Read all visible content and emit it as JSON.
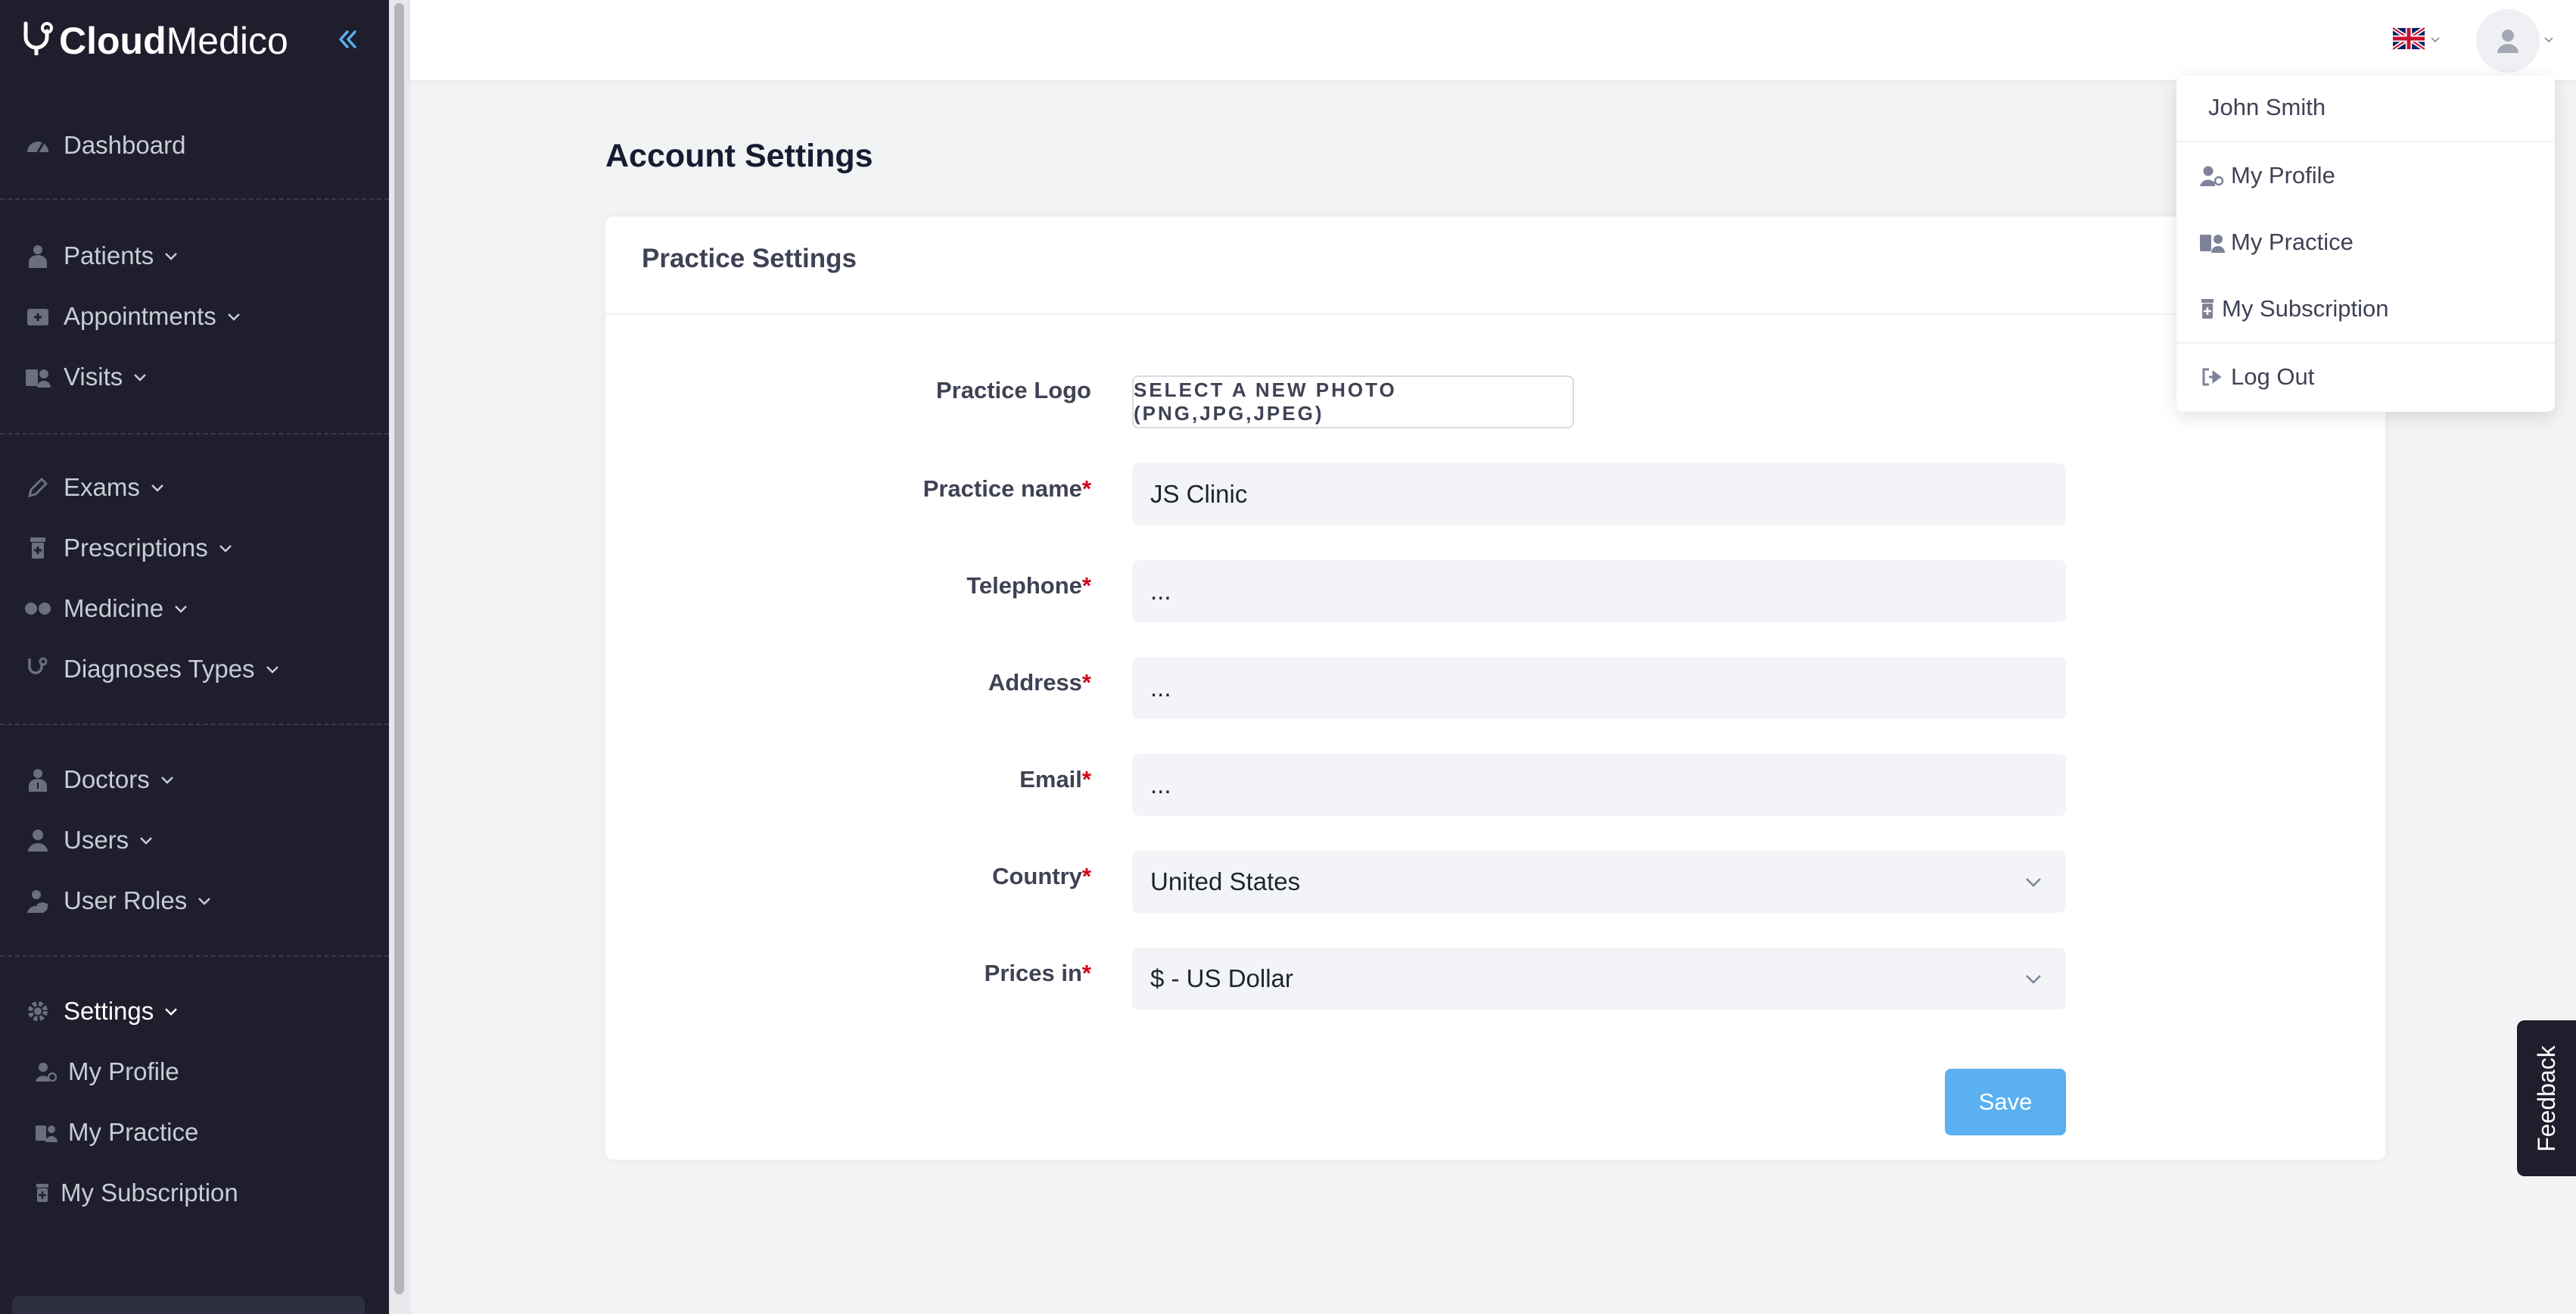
{
  "brand": {
    "part1": "Cloud",
    "part2": "Medico"
  },
  "sidebar": {
    "items": [
      {
        "label": "Dashboard",
        "icon": "speedometer-icon"
      },
      {
        "label": "Patients",
        "icon": "patient-icon"
      },
      {
        "label": "Appointments",
        "icon": "calendar-plus-icon"
      },
      {
        "label": "Visits",
        "icon": "visits-icon"
      },
      {
        "label": "Exams",
        "icon": "pencil-icon"
      },
      {
        "label": "Prescriptions",
        "icon": "prescription-icon"
      },
      {
        "label": "Medicine",
        "icon": "pills-icon"
      },
      {
        "label": "Diagnoses Types",
        "icon": "stethoscope-icon"
      },
      {
        "label": "Doctors",
        "icon": "doctor-icon"
      },
      {
        "label": "Users",
        "icon": "user-icon"
      },
      {
        "label": "User Roles",
        "icon": "user-shield-icon"
      },
      {
        "label": "Settings",
        "icon": "gear-icon"
      }
    ],
    "settings_sub": [
      {
        "label": "My Profile",
        "icon": "user-gear-icon"
      },
      {
        "label": "My Practice",
        "icon": "practice-icon"
      },
      {
        "label": "My Subscription",
        "icon": "subscription-icon"
      }
    ]
  },
  "header": {
    "language": "uk-flag-icon"
  },
  "page": {
    "title": "Account Settings"
  },
  "card": {
    "title": "Practice Settings",
    "logo_label": "Practice Logo",
    "photo_button": "SELECT A NEW PHOTO (PNG,JPG,JPEG)",
    "required_mark": "*",
    "fields": [
      {
        "label": "Practice name",
        "value": "JS Clinic"
      },
      {
        "label": "Telephone",
        "value": "..."
      },
      {
        "label": "Address",
        "value": "..."
      },
      {
        "label": "Email",
        "value": "..."
      },
      {
        "label": "Country",
        "value": "United States"
      },
      {
        "label": "Prices in",
        "value": "$ - US Dollar"
      }
    ],
    "save_label": "Save"
  },
  "dropdown": {
    "name": "John Smith",
    "items": [
      {
        "label": "My Profile",
        "icon": "user-gear-icon"
      },
      {
        "label": "My Practice",
        "icon": "practice-icon"
      },
      {
        "label": "My Subscription",
        "icon": "subscription-icon"
      },
      {
        "label": "Log Out",
        "icon": "logout-icon"
      }
    ]
  },
  "feedback": {
    "label": "Feedback"
  },
  "colors": {
    "sidebar_bg": "#1e1e2d",
    "accent": "#5ab0f0",
    "required": "#d0021b"
  }
}
